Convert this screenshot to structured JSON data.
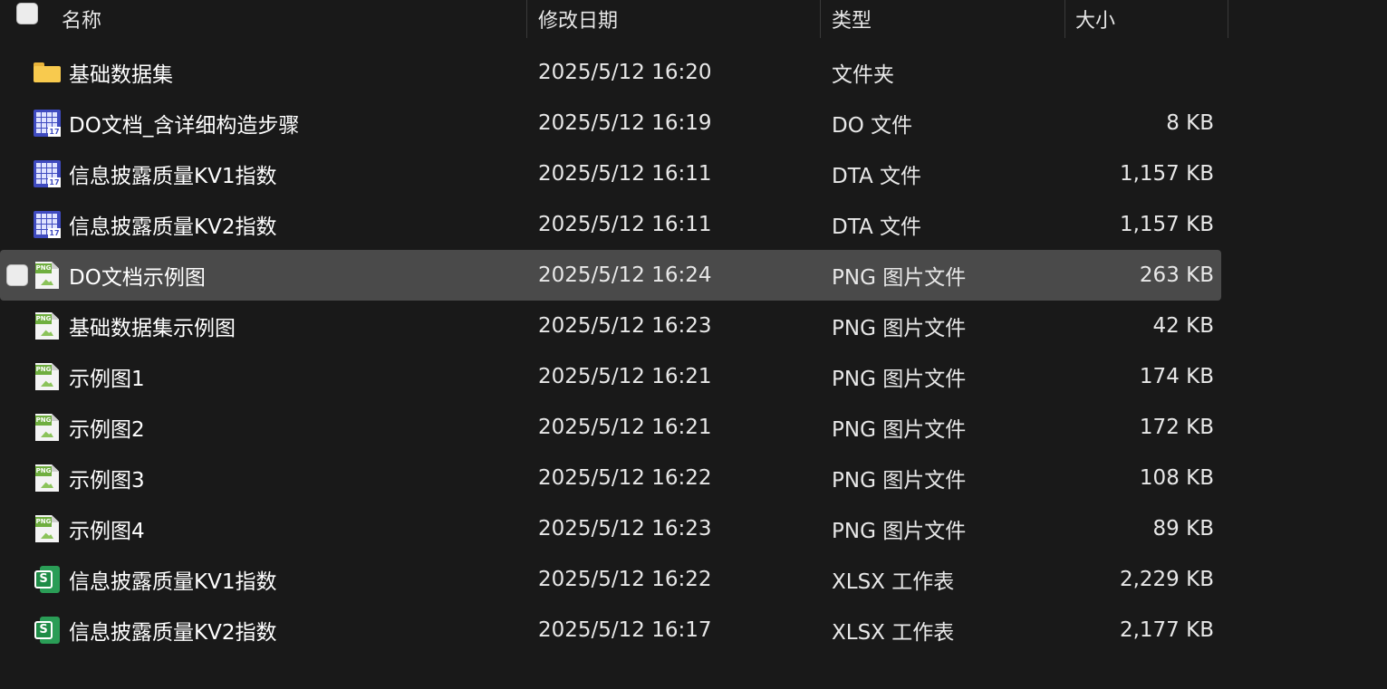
{
  "header": {
    "name_label": "名称",
    "date_label": "修改日期",
    "type_label": "类型",
    "size_label": "大小"
  },
  "files": [
    {
      "name": "基础数据集",
      "date": "2025/5/12 16:20",
      "type": "文件夹",
      "size": "",
      "icon": "folder-icon"
    },
    {
      "name": "DO文档_含详细构造步骤",
      "date": "2025/5/12 16:19",
      "type": "DO 文件",
      "size": "8 KB",
      "icon": "stata-file-icon"
    },
    {
      "name": "信息披露质量KV1指数",
      "date": "2025/5/12 16:11",
      "type": "DTA 文件",
      "size": "1,157 KB",
      "icon": "stata-file-icon"
    },
    {
      "name": "信息披露质量KV2指数",
      "date": "2025/5/12 16:11",
      "type": "DTA 文件",
      "size": "1,157 KB",
      "icon": "stata-file-icon"
    },
    {
      "name": "DO文档示例图",
      "date": "2025/5/12 16:24",
      "type": "PNG 图片文件",
      "size": "263 KB",
      "icon": "png-file-icon",
      "selected": true
    },
    {
      "name": "基础数据集示例图",
      "date": "2025/5/12 16:23",
      "type": "PNG 图片文件",
      "size": "42 KB",
      "icon": "png-file-icon"
    },
    {
      "name": "示例图1",
      "date": "2025/5/12 16:21",
      "type": "PNG 图片文件",
      "size": "174 KB",
      "icon": "png-file-icon"
    },
    {
      "name": "示例图2",
      "date": "2025/5/12 16:21",
      "type": "PNG 图片文件",
      "size": "172 KB",
      "icon": "png-file-icon"
    },
    {
      "name": "示例图3",
      "date": "2025/5/12 16:22",
      "type": "PNG 图片文件",
      "size": "108 KB",
      "icon": "png-file-icon"
    },
    {
      "name": "示例图4",
      "date": "2025/5/12 16:23",
      "type": "PNG 图片文件",
      "size": "89 KB",
      "icon": "png-file-icon"
    },
    {
      "name": "信息披露质量KV1指数",
      "date": "2025/5/12 16:22",
      "type": "XLSX 工作表",
      "size": "2,229 KB",
      "icon": "xlsx-file-icon"
    },
    {
      "name": "信息披露质量KV2指数",
      "date": "2025/5/12 16:17",
      "type": "XLSX 工作表",
      "size": "2,177 KB",
      "icon": "xlsx-file-icon"
    }
  ],
  "icon_labels": {
    "stata_number": "17",
    "png_badge": "PNG",
    "xlsx_badge": "S"
  },
  "colors": {
    "background": "#191919",
    "selected_row": "#4a4a4a",
    "folder": "#f8ca4e",
    "stata": "#3f4bc0",
    "png": "#6fae3f",
    "xlsx": "#2a9d56"
  }
}
